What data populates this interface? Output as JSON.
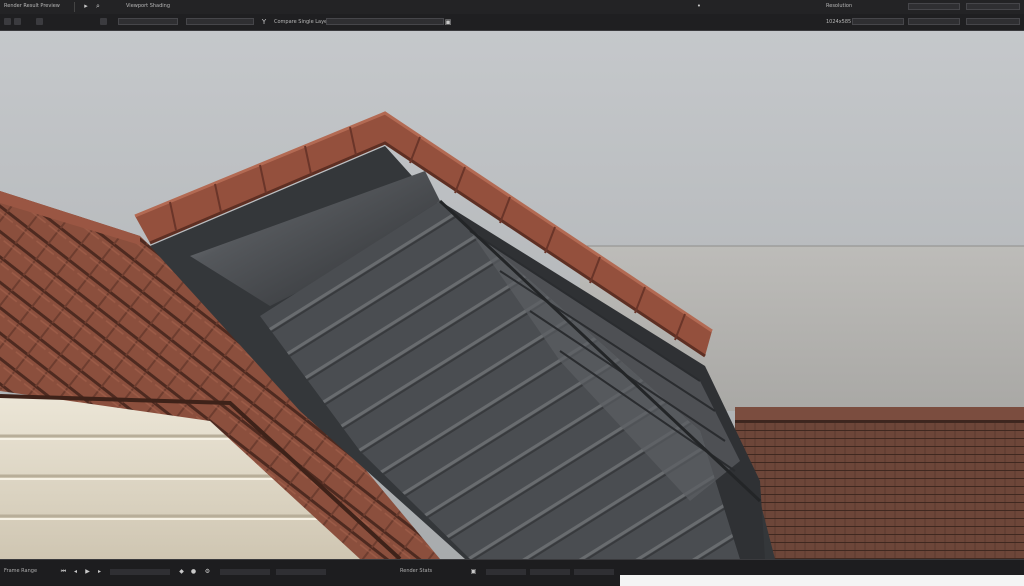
{
  "toolbar": {
    "row1_left_label": "Render Result Preview",
    "row1_mid_label": "Viewport Shading",
    "row1_right_label": "Resolution",
    "row2_field_label": "Compare Single Layer",
    "row2_right_label": "1024x585"
  },
  "bottom": {
    "frame_label": "Frame Range",
    "stats_label": "Render Stats"
  },
  "icons": {
    "cursor": "pointer-icon",
    "search": "search-icon",
    "tool": "brush-icon",
    "camera": "camera-icon",
    "play": "play-icon",
    "settings": "gear-icon"
  },
  "colors": {
    "toolbar_bg": "#1e1e20",
    "sky_top": "#c1c5c8",
    "sky_bottom": "#9fa3a6",
    "wall_gray": "#b9b8b5",
    "tile_terracotta": "#8a4e3c",
    "metal_dark": "#3b3d40",
    "metal_light": "#8b8e91",
    "cream_wall": "#e3dccc",
    "far_roof": "#6f4a3e"
  }
}
